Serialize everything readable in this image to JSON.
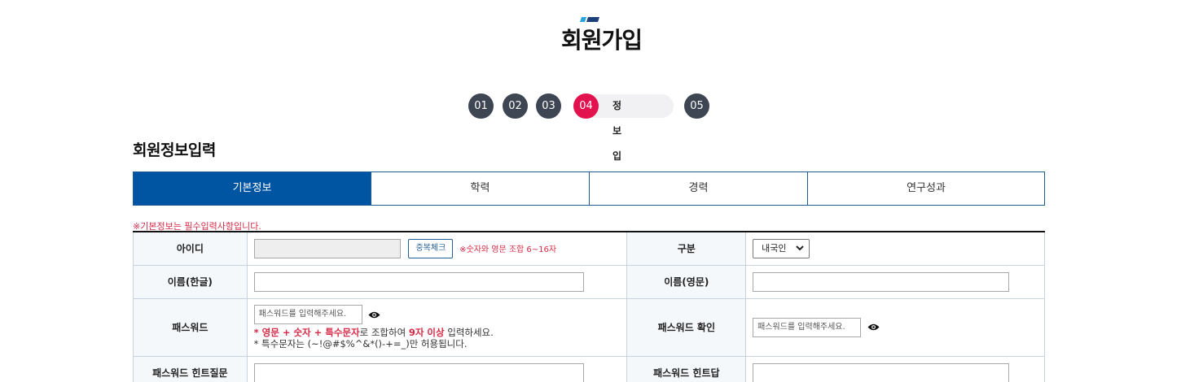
{
  "colors": {
    "primary": "#0055a3",
    "step_dark": "#3d4652",
    "step_active": "#e2124e",
    "required_red": "#d62b47"
  },
  "page_title": "회원가입",
  "steps": [
    {
      "number": "01",
      "active": false
    },
    {
      "number": "02",
      "active": false
    },
    {
      "number": "03",
      "active": false
    },
    {
      "number": "04",
      "active": true,
      "label": "정보입력"
    },
    {
      "number": "05",
      "active": false
    }
  ],
  "section_title": "회원정보입력",
  "tabs": [
    {
      "label": "기본정보",
      "active": true
    },
    {
      "label": "학력",
      "active": false
    },
    {
      "label": "경력",
      "active": false
    },
    {
      "label": "연구성과",
      "active": false
    }
  ],
  "required_note": "※기본정보는 필수입력사항입니다.",
  "form": {
    "id_label": "아이디",
    "id_value": "",
    "dup_check_button": "중복체크",
    "id_rule": "※숫자와 영문 조합 6~16자",
    "type_label": "구분",
    "type_selected": "내국인",
    "name_kr_label": "이름(한글)",
    "name_kr_value": "",
    "name_en_label": "이름(영문)",
    "name_en_value": "",
    "password_label": "패스워드",
    "password_placeholder": "패스워드를 입력해주세요.",
    "password_help": {
      "prefix": "* ",
      "highlight1": "영문 + 숫자 + 특수문자",
      "mid": "로 조합하여 ",
      "highlight2": "9자 이상",
      "suffix": " 입력하세요.",
      "line2": "* 특수문자는 (~!@#$%^&*()-+=_)만 허용됩니다."
    },
    "password_confirm_label": "패스워드 확인",
    "password_confirm_placeholder": "패스워드를 입력해주세요.",
    "hint_question_label": "패스워드 힌트질문",
    "hint_answer_label": "패스워드 힌트답"
  },
  "icons": {
    "eye": "eye-icon",
    "chevron": "chevron-down-icon"
  }
}
